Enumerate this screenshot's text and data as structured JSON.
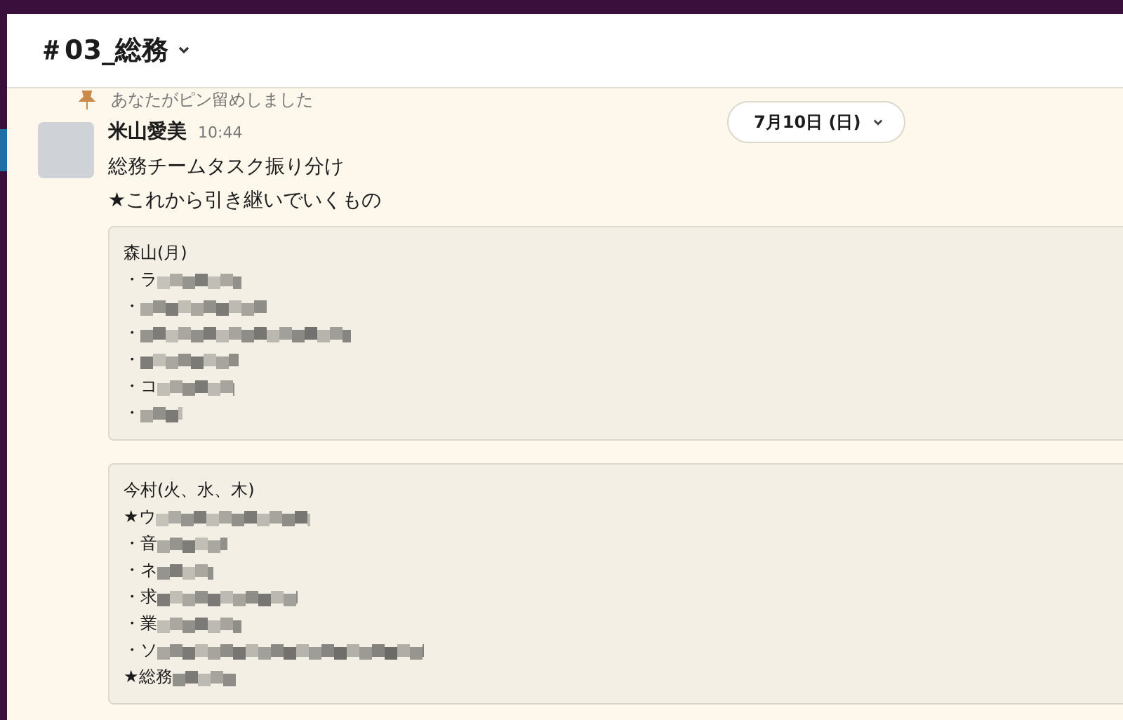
{
  "channel": {
    "name": "＃03_総務"
  },
  "date_pill": {
    "label": "7月10日 (日)"
  },
  "pin_notice": "あなたがピン留めしました",
  "message": {
    "author": "米山愛美",
    "time": "10:44",
    "lines": [
      "総務チームタスク振り分け",
      "★これから引き継いでいくもの"
    ],
    "blocks": [
      {
        "heading": "森山(月)",
        "items": [
          "・ラ",
          "・",
          "・",
          "・",
          "・コ",
          "・"
        ]
      },
      {
        "heading": "今村(火、水、木)",
        "items": [
          "★ウ",
          "・音",
          "・ネ",
          "・求",
          "・業",
          "・ソ",
          "★総務"
        ]
      }
    ]
  }
}
